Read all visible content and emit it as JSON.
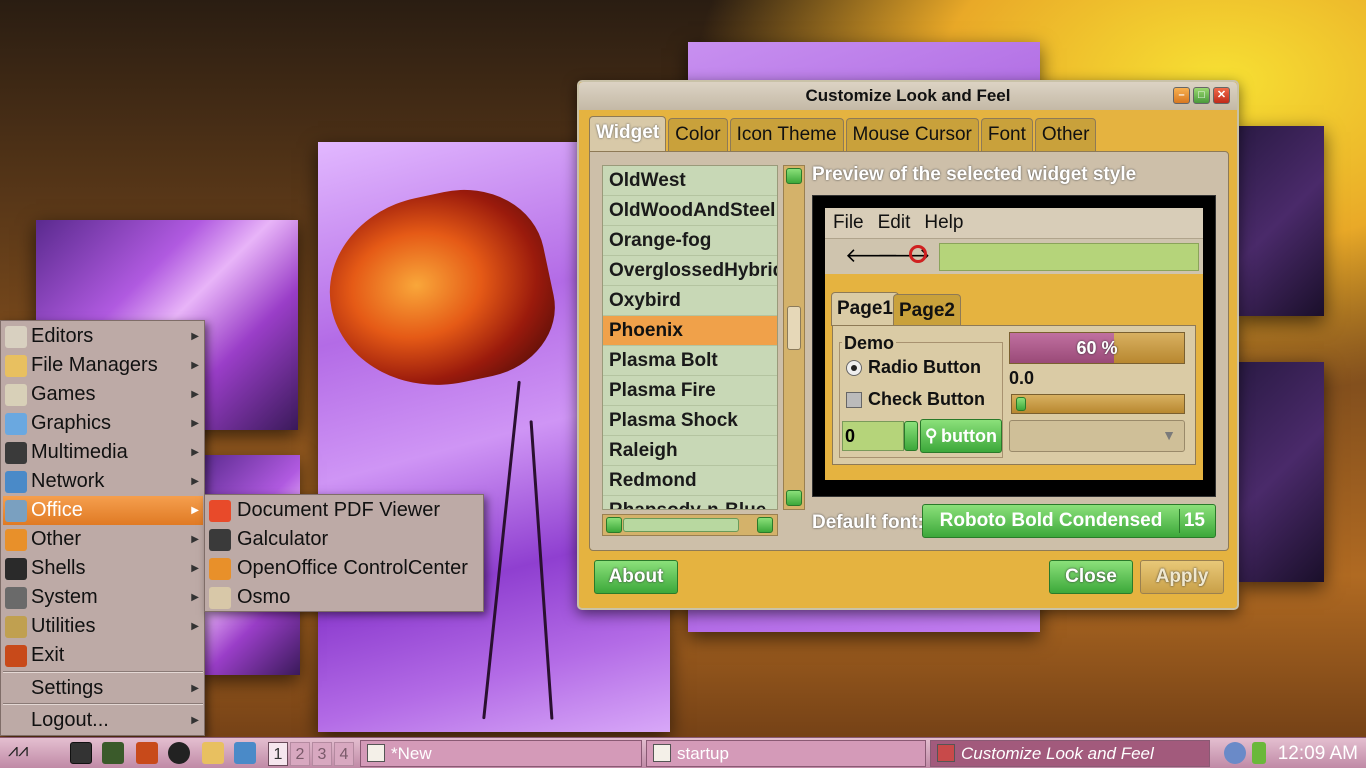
{
  "start_menu": {
    "items": [
      {
        "label": "Editors",
        "icon": "editor-icon",
        "color": "#d8d0c0"
      },
      {
        "label": "File Managers",
        "icon": "folder-icon",
        "color": "#e8c060"
      },
      {
        "label": "Games",
        "icon": "games-icon",
        "color": "#d8d0b8"
      },
      {
        "label": "Graphics",
        "icon": "graphics-icon",
        "color": "#6aa8e0"
      },
      {
        "label": "Multimedia",
        "icon": "multimedia-icon",
        "color": "#3a3a3a"
      },
      {
        "label": "Network",
        "icon": "network-icon",
        "color": "#4a8ac8"
      },
      {
        "label": "Office",
        "icon": "office-icon",
        "color": "#7aa0c0"
      },
      {
        "label": "Other",
        "icon": "other-icon",
        "color": "#e8902a"
      },
      {
        "label": "Shells",
        "icon": "terminal-icon",
        "color": "#2a2a2a"
      },
      {
        "label": "System",
        "icon": "system-icon",
        "color": "#6a6a6a"
      },
      {
        "label": "Utilities",
        "icon": "utilities-icon",
        "color": "#c0a050"
      },
      {
        "label": "Exit",
        "icon": "exit-icon",
        "color": "#c84a1a"
      }
    ],
    "settings_label": "Settings",
    "logout_label": "Logout..."
  },
  "office_submenu": {
    "items": [
      {
        "label": "Document PDF Viewer",
        "icon": "pdf-viewer-icon",
        "color": "#e84a2a"
      },
      {
        "label": "Galculator",
        "icon": "calculator-icon",
        "color": "#3a3a3a"
      },
      {
        "label": "OpenOffice ControlCenter",
        "icon": "openoffice-icon",
        "color": "#e8902a"
      },
      {
        "label": "Osmo",
        "icon": "osmo-icon",
        "color": "#d8c8a8"
      }
    ]
  },
  "dialog": {
    "title": "Customize Look and Feel",
    "tabs": [
      "Widget",
      "Color",
      "Icon Theme",
      "Mouse Cursor",
      "Font",
      "Other"
    ],
    "themes": [
      "OldWest",
      "OldWoodAndSteel",
      "Orange-fog",
      "OverglossedHybrid",
      "Oxybird",
      "Phoenix",
      "Plasma Bolt",
      "Plasma Fire",
      "Plasma Shock",
      "Raleigh",
      "Redmond",
      "Rhapsody-n-Blue"
    ],
    "selected_theme": "Phoenix",
    "preview_label": "Preview of the selected widget style",
    "preview": {
      "menu": [
        "File",
        "Edit",
        "Help"
      ],
      "tabs": [
        "Page1",
        "Page2"
      ],
      "demo_label": "Demo",
      "radio_label": "Radio Button",
      "check_label": "Check Button",
      "spin_value": "0",
      "button_label": "button",
      "progress_text": "60 %",
      "progress": 0.6,
      "scale_value": "0.0"
    },
    "default_font_label": "Default font:",
    "font_name": "Roboto Bold Condensed",
    "font_size": "15",
    "about_label": "About",
    "close_label": "Close",
    "apply_label": "Apply"
  },
  "taskbar": {
    "workspaces": [
      "1",
      "2",
      "3",
      "4"
    ],
    "tasks": [
      "*New",
      "startup",
      "Customize Look and Feel"
    ],
    "clock": "12:09 AM"
  }
}
